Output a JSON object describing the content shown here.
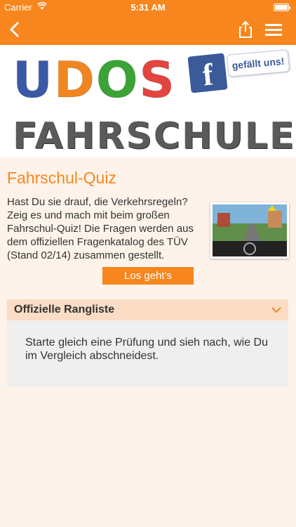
{
  "status": {
    "carrier": "Carrier",
    "time": "5:31 AM"
  },
  "nav": {
    "back": "back",
    "share": "share",
    "menu": "menu"
  },
  "banner": {
    "udos": [
      "U",
      "D",
      "O",
      "S"
    ],
    "udos_colors": [
      "#3a59a6",
      "#f18621",
      "#3aa437",
      "#e4443f"
    ],
    "fahrschule": "FAHRSCHULE",
    "fb_letter": "f",
    "fb_like": "gefällt uns!"
  },
  "content": {
    "title": "Fahrschul-Quiz",
    "intro": "Hast Du sie drauf, die Verkehrsregeln? Zeig es und mach mit beim großen Fahrschul-Quiz! Die Fragen werden aus dem offiziellen Fragenkatalog des TÜV (Stand 02/14) zusammen gestellt.",
    "cta": "Los geht's"
  },
  "ranking": {
    "header": "Offizielle Rangliste",
    "body": "Starte gleich eine Prüfung und sieh nach, wie Du im Vergleich abschneidest."
  },
  "colors": {
    "accent": "#f7861e",
    "background": "#fdf3ea"
  }
}
